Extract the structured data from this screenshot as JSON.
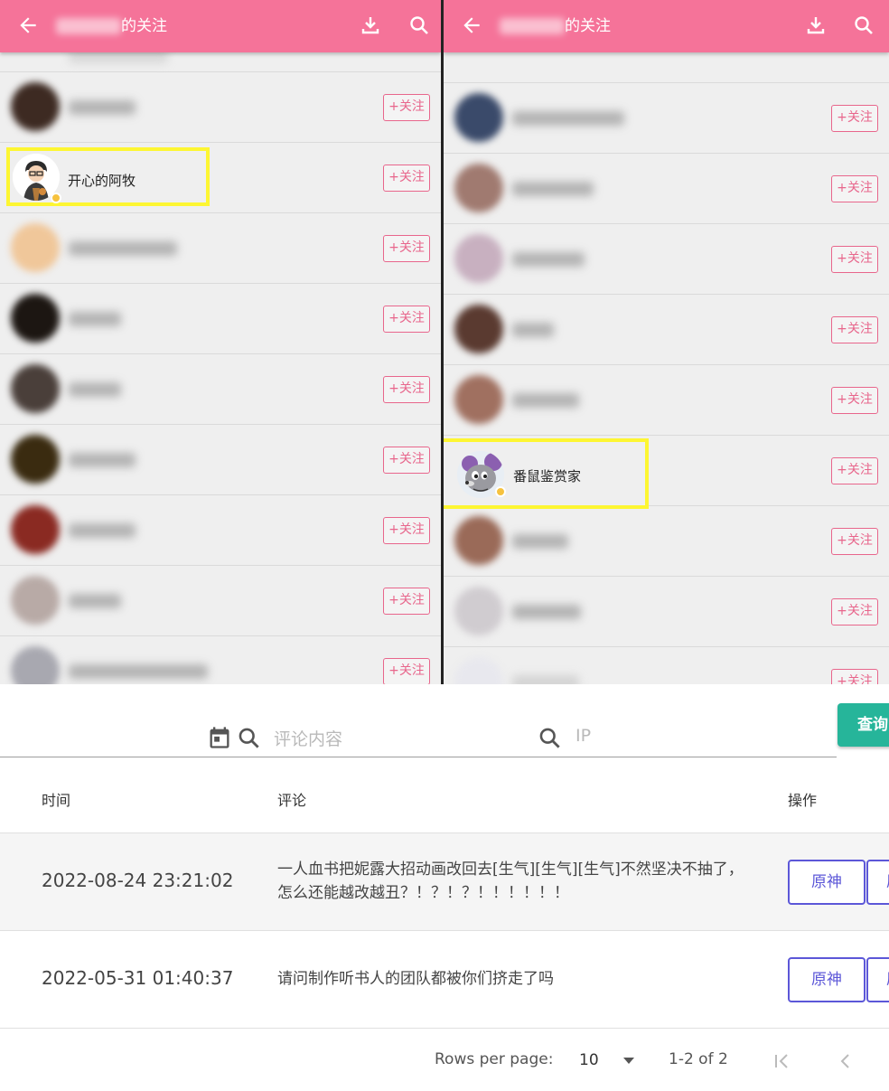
{
  "left_panel": {
    "title_suffix": "的关注",
    "follow_label": "+关注",
    "highlighted_user": "开心的阿牧"
  },
  "right_panel": {
    "title_suffix": "的关注",
    "follow_label": "+关注",
    "highlighted_user": "番鼠鉴赏家"
  },
  "search": {
    "comment_placeholder": "评论内容",
    "ip_placeholder": "IP",
    "query_label": "查询"
  },
  "table": {
    "headers": {
      "time": "时间",
      "comment": "评论",
      "action": "操作"
    },
    "rows": [
      {
        "time": "2022-08-24 23:21:02",
        "comment": "一人血书把妮露大招动画改回去[生气][生气][生气]不然坚决不抽了，怎么还能越改越丑？！？！？！！！！！！",
        "action": "原神",
        "action2": "原"
      },
      {
        "time": "2022-05-31 01:40:37",
        "comment": "请问制作听书人的团队都被你们挤走了吗",
        "action": "原神",
        "action2": "原"
      }
    ]
  },
  "pagination": {
    "rows_per_page_label": "Rows per page:",
    "rows_per_page_value": "10",
    "range": "1-2 of 2"
  },
  "colors": {
    "appbar": "#f57399",
    "follow": "#e8668c",
    "highlight": "#fdf632",
    "query_button": "#26b59a",
    "action_button": "#5c57d8"
  }
}
